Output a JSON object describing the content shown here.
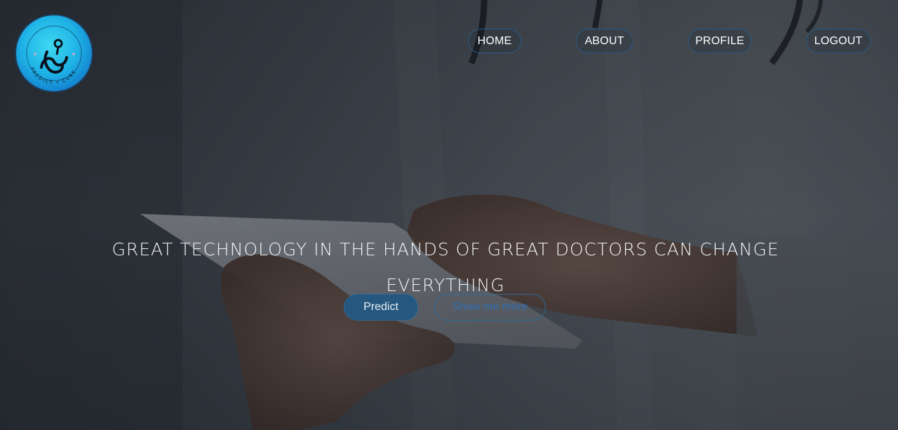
{
  "brand": {
    "logo_text": "PREDICT • CURE",
    "logo_icon": "stethoscope-icon",
    "colors": {
      "logo_light": "#3fd8f2",
      "logo_dark": "#0d5fb4"
    }
  },
  "nav": {
    "home": "HOME",
    "about": "ABOUT",
    "profile": "PROFILE",
    "logout": "LOGOUT"
  },
  "hero": {
    "headline": "GREAT TECHNOLOGY IN THE HANDS OF GREAT DOCTORS CAN CHANGE EVERYTHING",
    "primary_button": "Predict",
    "secondary_button": "Show me more",
    "colors": {
      "accent": "#25577f",
      "link": "#2f6fb3"
    }
  }
}
